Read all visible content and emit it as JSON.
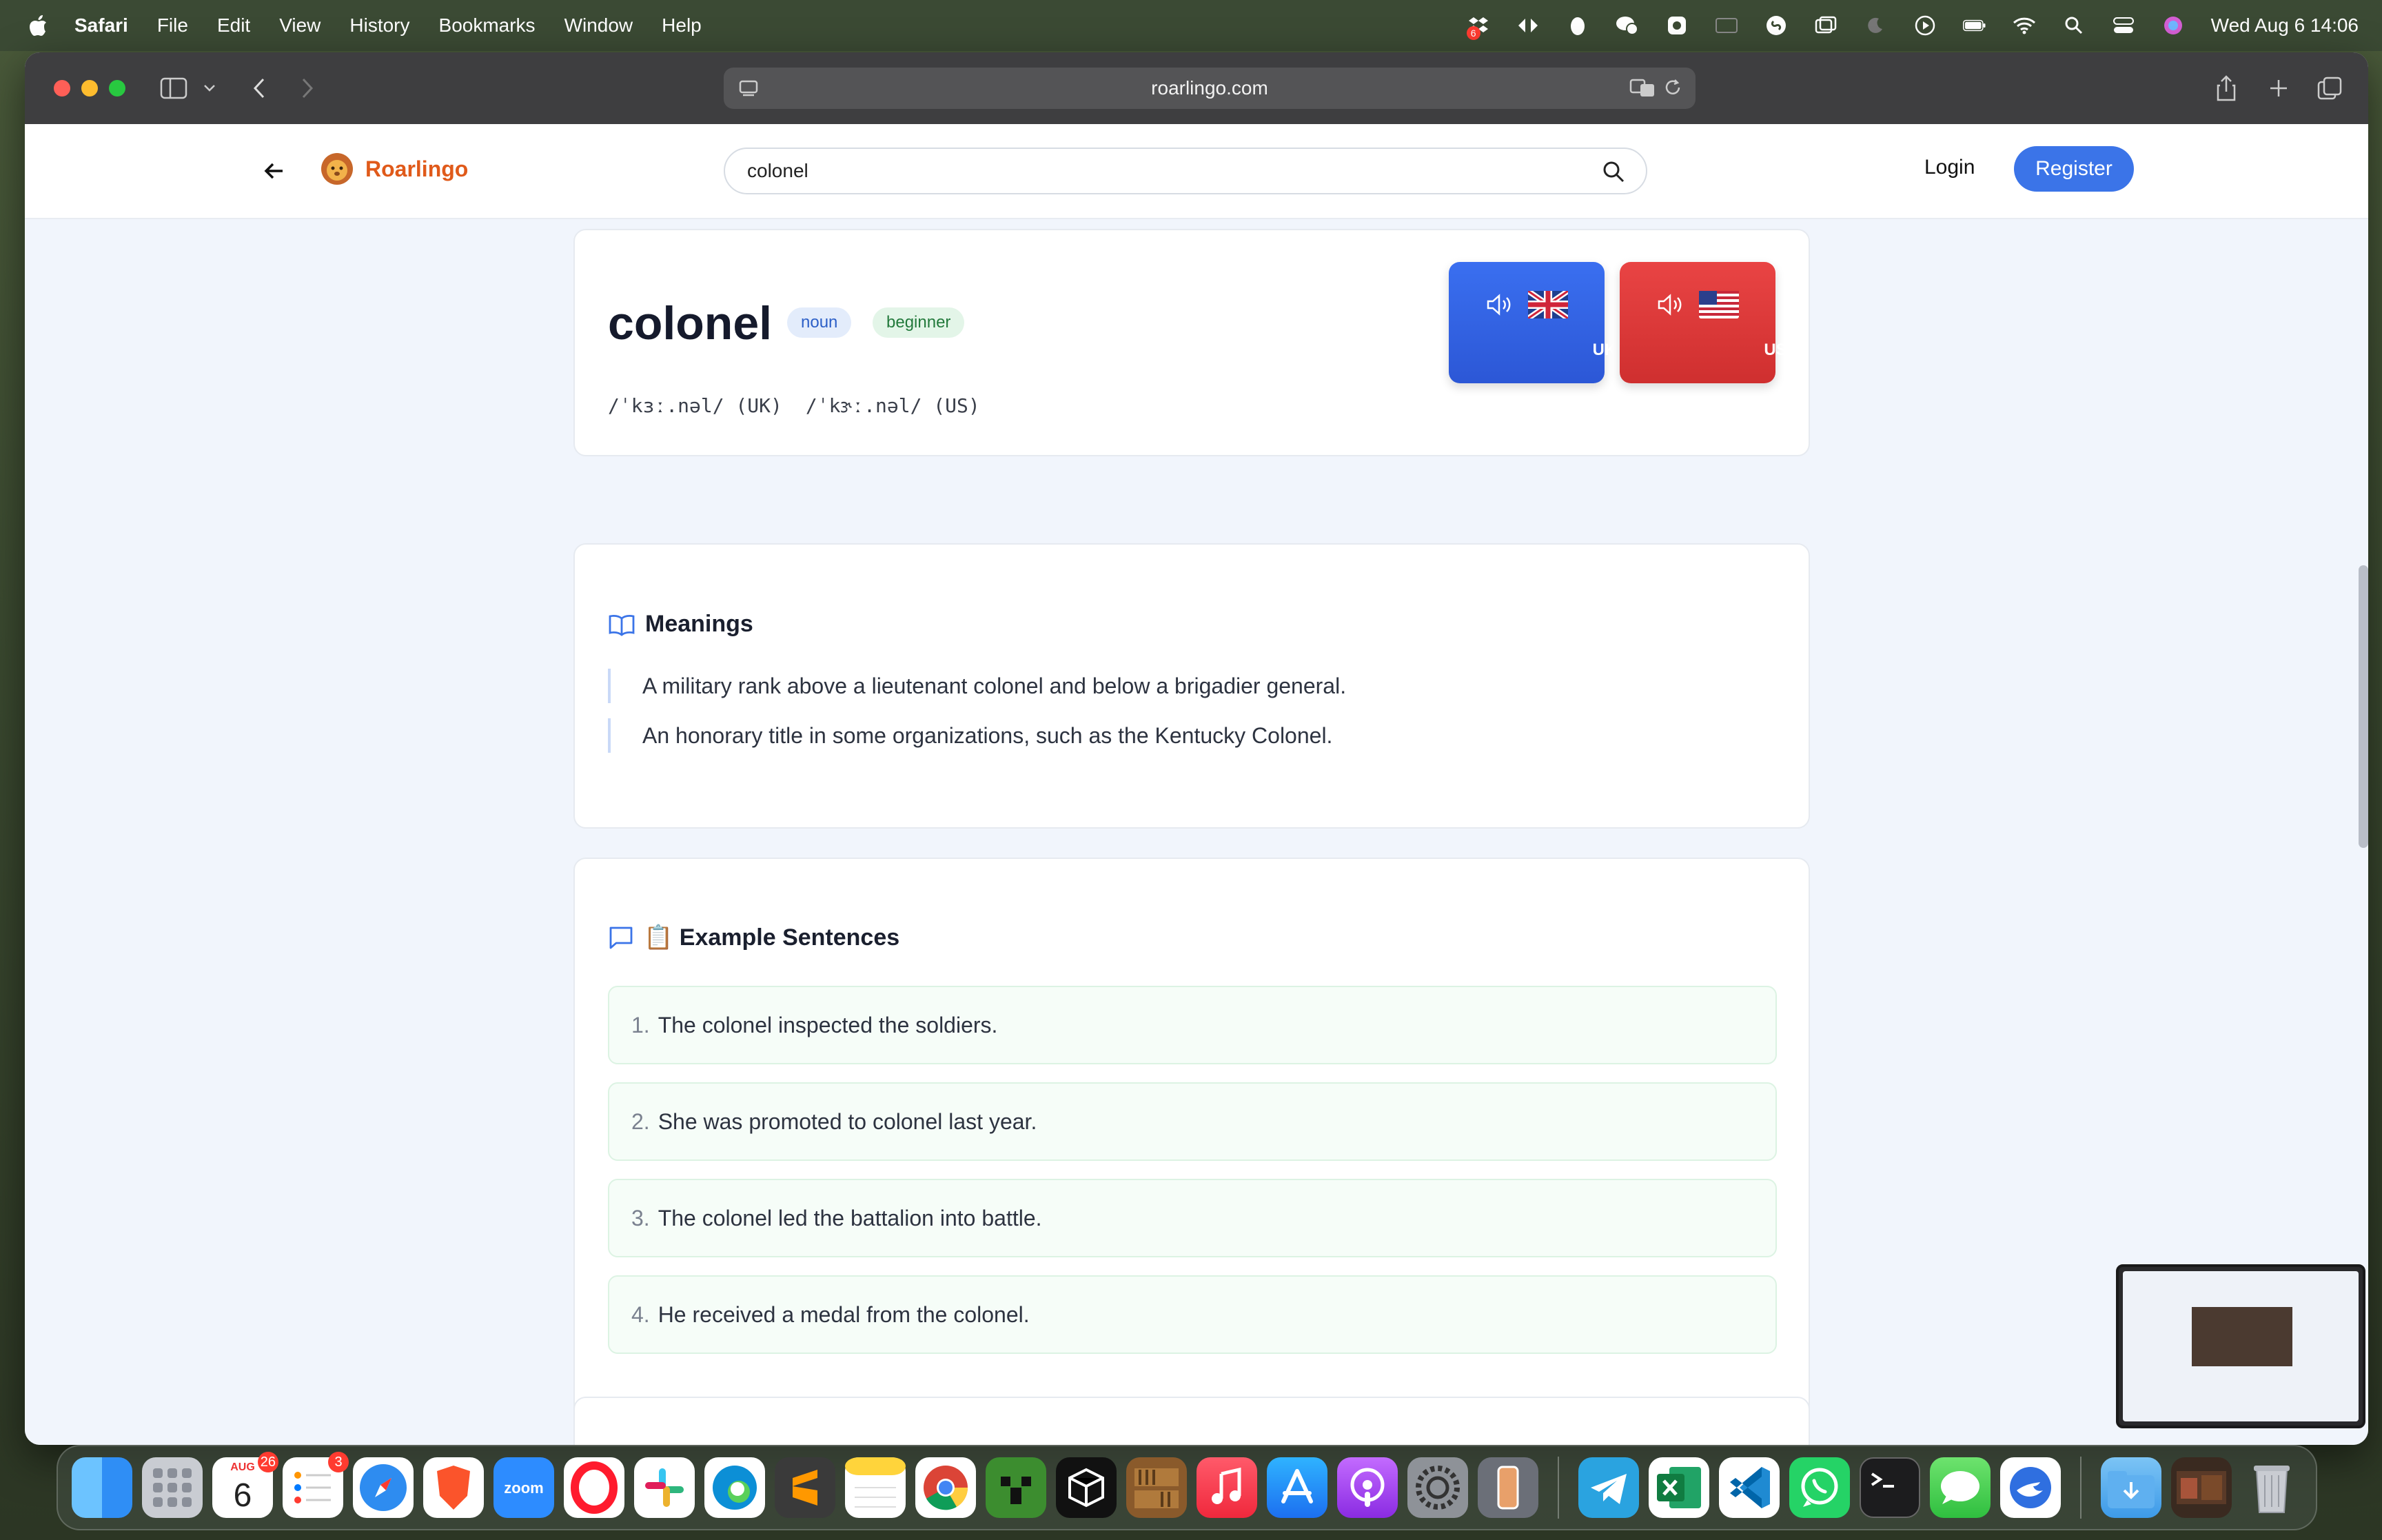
{
  "menubar": {
    "app_name": "Safari",
    "items": [
      "File",
      "Edit",
      "View",
      "History",
      "Bookmarks",
      "Window",
      "Help"
    ],
    "clock": "Wed Aug 6  14:06",
    "notification_count": "6"
  },
  "browser": {
    "url": "roarlingo.com"
  },
  "site": {
    "logo_text": "Roarlingo",
    "search_value": "colonel",
    "login_label": "Login",
    "register_label": "Register"
  },
  "word": {
    "text": "colonel",
    "pos": "noun",
    "level": "beginner",
    "ipa_uk": "/ˈkɜː.nəl/ (UK)",
    "ipa_us": "/ˈkɝː.nəl/ (US)",
    "uk_label": "UK",
    "us_label": "US"
  },
  "meanings": {
    "title": "Meanings",
    "items": [
      "A military rank above a lieutenant colonel and below a brigadier general.",
      "An honorary title in some organizations, such as the Kentucky Colonel."
    ]
  },
  "examples": {
    "title": "📋 Example Sentences",
    "items": [
      {
        "num": "1.",
        "text": "The colonel inspected the soldiers."
      },
      {
        "num": "2.",
        "text": "She was promoted to colonel last year."
      },
      {
        "num": "3.",
        "text": "The colonel led the battalion into battle."
      },
      {
        "num": "4.",
        "text": "He received a medal from the colonel."
      }
    ]
  },
  "dock": {
    "calendar_month": "AUG",
    "calendar_day": "6",
    "calendar_badge": "26",
    "reminders_badge": "3",
    "zoom_label": "zoom"
  },
  "colors": {
    "brand": "#e05a1a",
    "primary": "#3b74e8",
    "uk_button": "#2c57d6",
    "us_button": "#cf2f2f"
  }
}
